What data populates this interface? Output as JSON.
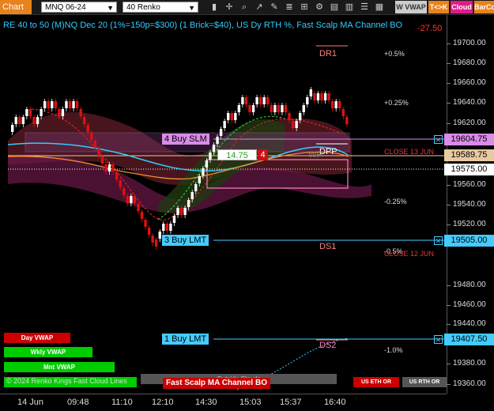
{
  "toolbar": {
    "chart_tab": "Chart",
    "instrument": "MNQ 06-24",
    "bar_type": "40 Renko",
    "wvwap": "W VWAP",
    "tk": "T<>K",
    "cloud": "Cloud",
    "barcolor": "BarCo"
  },
  "header": {
    "title": "RE 40 to 50 (M)NQ Dec 20 (1%=150p=$300) (1 Brick=$40), US Dy RTH %, Fast Scalp MA Channel BO",
    "right_value": "-27.50"
  },
  "price_axis": {
    "ticks": [
      "19700.00",
      "19680.00",
      "19660.00",
      "19640.00",
      "19620.00",
      "19560.00",
      "19540.00",
      "19520.00",
      "19480.00",
      "19460.00",
      "19440.00",
      "19420.00",
      "19380.00",
      "19360.00"
    ],
    "badges": {
      "b1": "19604.75",
      "b2": "19589.75",
      "b3": "19575.00",
      "b4": "19505.00",
      "b5": "19407.50"
    }
  },
  "time_axis": [
    "14 Jun",
    "09:48",
    "11:10",
    "12:10",
    "14:30",
    "15:03",
    "15:37",
    "16:40"
  ],
  "orders": {
    "buy_slm": "4 Buy SLM",
    "buy_lmt3": "3 Buy LMT",
    "buy_lmt1": "1 Buy LMT",
    "pnl": "14.75",
    "qty": "4",
    "x": "✕"
  },
  "levels": {
    "dr1": "DR1",
    "dpp": "DPP",
    "ds1": "DS1",
    "ds2": "DS2",
    "wpp": "WP"
  },
  "percents": {
    "p05": "+0.5%",
    "p025": "+0.25%",
    "m025": "-0.25%",
    "m05": "-0.5%",
    "m1": "-1.0%"
  },
  "closes": {
    "c13": "CLOSE 13 JUN",
    "c12": "CLOSE 12 JUN"
  },
  "bottom": {
    "day_vwap": "Day VWAP",
    "wkly_vwap": "Wkly VWAP",
    "mnt_vwap": "Mnt VWAP",
    "copyright": "© 2024 Renko Kings Fast Cloud Lines",
    "fast_scalp": "Fast Scalp MA Channel BO",
    "outside": "Outside Clouds",
    "us_eth": "US ETH OR",
    "us_rth": "US RTH OR"
  },
  "colors": {
    "up_brick": "#ffffff",
    "down_brick": "#e01010",
    "accent_cyan": "#33ccff",
    "order_cyan": "#44ccff",
    "slm_violet": "#d98be8",
    "vwap_red": "#cc0000",
    "vwap_green": "#00cc00"
  }
}
